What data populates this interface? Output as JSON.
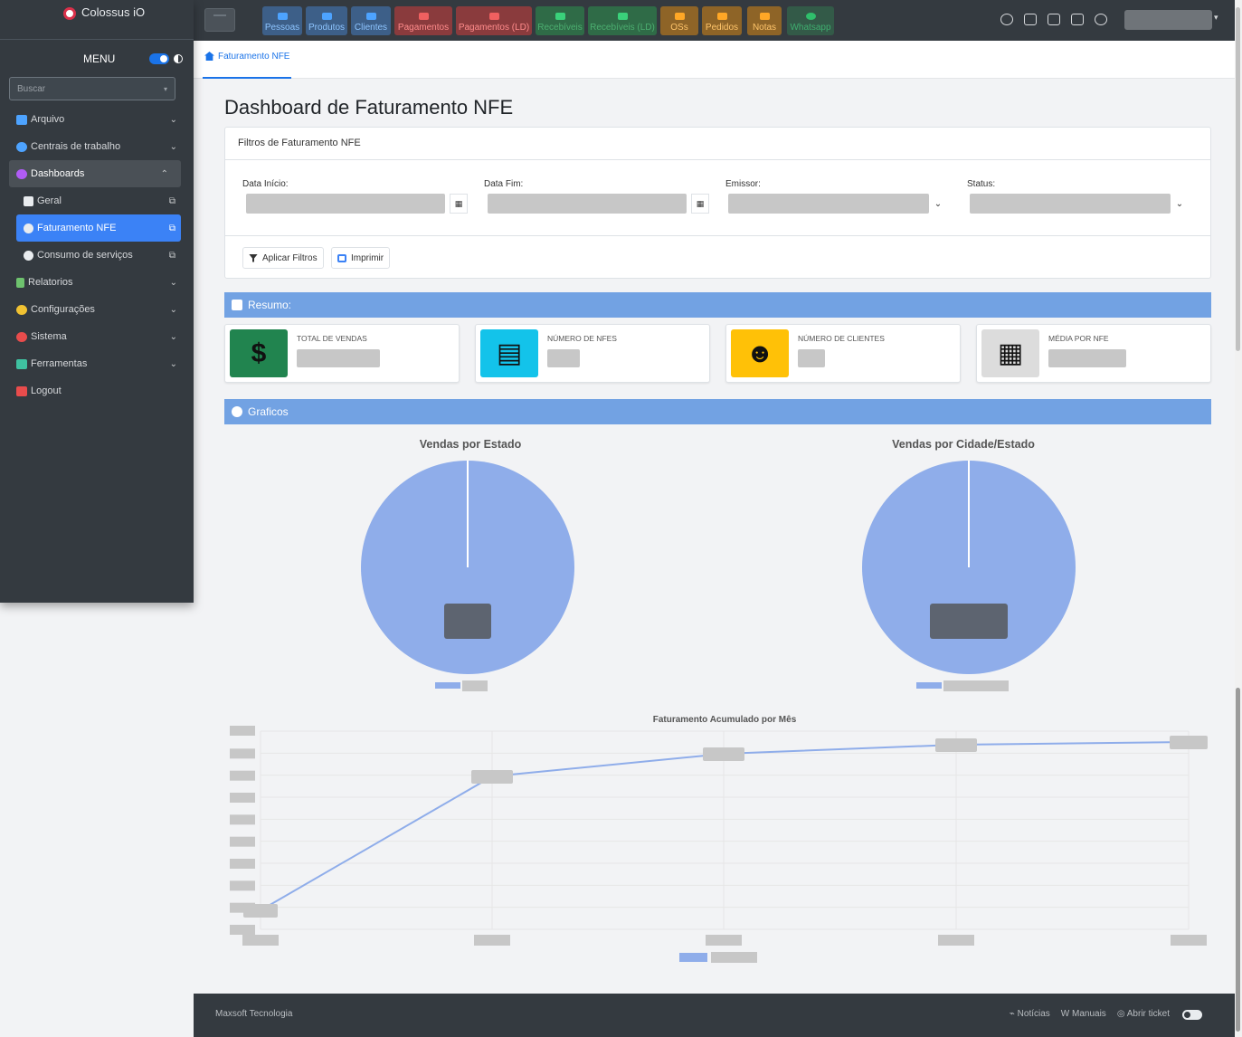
{
  "app": {
    "title": "Colossus iO"
  },
  "sidebar": {
    "menu_label": "MENU",
    "search_placeholder": "Buscar",
    "items": [
      {
        "label": "Arquivo",
        "icon": "folder-icon",
        "color": "#4da3ff"
      },
      {
        "label": "Centrais de trabalho",
        "icon": "gears-icon",
        "color": "#4da3ff"
      },
      {
        "label": "Dashboards",
        "icon": "dashboard-icon",
        "color": "#b05cf5"
      },
      {
        "label": "Relatorios",
        "icon": "report-icon",
        "color": "#6ec26e"
      },
      {
        "label": "Configurações",
        "icon": "settings-icon",
        "color": "#f1c232"
      },
      {
        "label": "Sistema",
        "icon": "system-icon",
        "color": "#e84c4c"
      },
      {
        "label": "Ferramentas",
        "icon": "tools-icon",
        "color": "#3fc1a1"
      },
      {
        "label": "Logout",
        "icon": "logout-icon",
        "color": "#e84c4c"
      }
    ],
    "subitems": [
      {
        "label": "Geral"
      },
      {
        "label": "Faturamento NFE"
      },
      {
        "label": "Consumo de serviços"
      }
    ]
  },
  "toolbar": {
    "buttons": [
      {
        "label": "Pessoas"
      },
      {
        "label": "Produtos"
      },
      {
        "label": "Clientes"
      },
      {
        "label": "Pagamentos"
      },
      {
        "label": "Pagamentos (LD)"
      },
      {
        "label": "Recebíveis"
      },
      {
        "label": "Recebíveis (LD)"
      },
      {
        "label": "OSs"
      },
      {
        "label": "Pedidos"
      },
      {
        "label": "Notas"
      },
      {
        "label": "Whatsapp"
      }
    ]
  },
  "breadcrumb": {
    "tab": "Faturamento NFE"
  },
  "page": {
    "title": "Dashboard de Faturamento NFE"
  },
  "filters": {
    "title": "Filtros de Faturamento NFE",
    "data_inicio": "Data Início:",
    "data_fim": "Data Fim:",
    "emissor": "Emissor:",
    "status": "Status:",
    "apply": "Aplicar Filtros",
    "print": "Imprimir"
  },
  "resumo": {
    "title": "Resumo:",
    "cards": [
      {
        "label": "TOTAL DE VENDAS",
        "color": "#21844f",
        "icon": "dollar-icon"
      },
      {
        "label": "NÚMERO DE NFES",
        "color": "#13c3ea",
        "icon": "document-icon"
      },
      {
        "label": "NÚMERO DE CLIENTES",
        "color": "#ffc107",
        "icon": "users-icon"
      },
      {
        "label": "MÉDIA POR NFE",
        "color": "#dcdcdc",
        "icon": "calculator-icon"
      }
    ]
  },
  "graficos": {
    "title": "Graficos"
  },
  "chart_data": [
    {
      "type": "pie",
      "title": "Vendas por Estado",
      "colors": [
        "#8fadea"
      ]
    },
    {
      "type": "pie",
      "title": "Vendas por Cidade/Estado",
      "colors": [
        "#8fadea"
      ]
    },
    {
      "type": "line",
      "title": "Faturamento Acumulado por Mês",
      "colors": [
        "#8fadea"
      ]
    }
  ],
  "footer": {
    "brand": "Maxsoft Tecnologia",
    "links": [
      "Notícias",
      "Manuais",
      "Abrir ticket"
    ]
  }
}
